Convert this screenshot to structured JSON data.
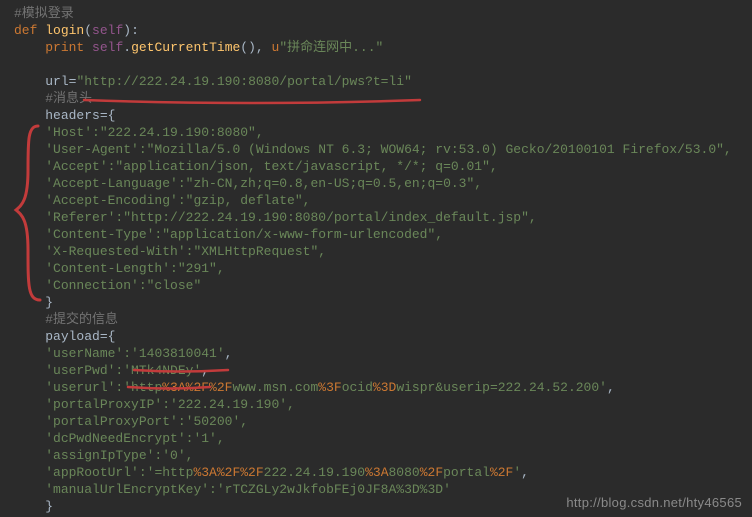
{
  "comments": {
    "login": "#模拟登录",
    "headers": "#消息头",
    "payload": "#提交的信息"
  },
  "code": {
    "def": "def",
    "fn_login": "login",
    "self": "self",
    "print": "print",
    "getCurrentTime": "getCurrentTime",
    "u": "u",
    "conn_str": "\"拼命连网中...\"",
    "url_var": "url",
    "url_val": "\"http://222.24.19.190:8080/portal/pws?t=li\"",
    "headers_var": "headers",
    "payload_var": "payload"
  },
  "headers": {
    "Host": "'Host':\"222.24.19.190:8080\",",
    "UserAgent": "'User-Agent':\"Mozilla/5.0 (Windows NT 6.3; WOW64; rv:53.0) Gecko/20100101 Firefox/53.0\",",
    "Accept": "'Accept':\"application/json, text/javascript, */*; q=0.01\",",
    "AcceptLanguage": "'Accept-Language':\"zh-CN,zh;q=0.8,en-US;q=0.5,en;q=0.3\",",
    "AcceptEncoding": "'Accept-Encoding':\"gzip, deflate\",",
    "Referer": "'Referer':\"http://222.24.19.190:8080/portal/index_default.jsp\",",
    "ContentType": "'Content-Type':\"application/x-www-form-urlencoded\",",
    "XRequestedWith": "'X-Requested-With':\"XMLHttpRequest\",",
    "ContentLength": "'Content-Length':\"291\",",
    "Connection": "'Connection':\"close\""
  },
  "payload": {
    "userName_k": "'userName':",
    "userName_v": "'1403810041'",
    "userPwd_k": "'userPwd':",
    "userPwd_v": "'MTk4NDEy'",
    "userurl_k": "'userurl':",
    "userurl_p1": "'http",
    "userurl_p2": "%3A%2F%2F",
    "userurl_p3": "www.msn.com",
    "userurl_p4": "%3F",
    "userurl_p5": "ocid",
    "userurl_p6": "%3D",
    "userurl_p7": "wispr&userip=222.24.52.200'",
    "portalProxyIP": "'portalProxyIP':'222.24.19.190',",
    "portalProxyPort": "'portalProxyPort':'50200',",
    "dcPwdNeedEncrypt": "'dcPwdNeedEncrypt':'1',",
    "assignIpType": "'assignIpType':'0',",
    "appRootUrl_k": "'appRootUrl':",
    "appRootUrl_p1": "'=http",
    "appRootUrl_p2": "%3A%2F%2F",
    "appRootUrl_p3": "222.24.19.190",
    "appRootUrl_p4": "%3A",
    "appRootUrl_p5": "8080",
    "appRootUrl_p6": "%2F",
    "appRootUrl_p7": "portal",
    "appRootUrl_p8": "%2F",
    "appRootUrl_p9": "'",
    "manualUrlEncryptKey": "'manualUrlEncryptKey':'rTCZGLy2wJkfobFEj0JF8A%3D%3D'"
  },
  "watermark": "http://blog.csdn.net/hty46565",
  "annotation_color": "#c23b3b"
}
